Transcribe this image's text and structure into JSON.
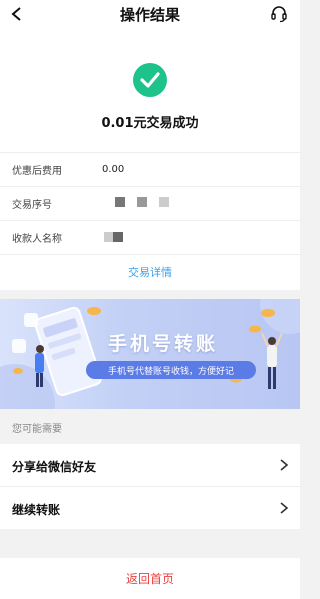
{
  "header": {
    "title": "操作结果",
    "back_icon": "chevron-left-icon",
    "support_icon": "headset-icon"
  },
  "result": {
    "status_icon": "check-circle-icon",
    "amount_text": "0.01元交易成功",
    "rows": [
      {
        "label": "优惠后费用",
        "value": "0.00"
      },
      {
        "label": "交易序号",
        "value": ""
      },
      {
        "label": "收款人名称",
        "value": ""
      }
    ],
    "detail_link": "交易详情"
  },
  "banner": {
    "title": "手机号转账",
    "subtitle": "手机号代替账号收钱，方便好记"
  },
  "section": {
    "label": "您可能需要"
  },
  "actions": [
    {
      "label": "分享给微信好友"
    },
    {
      "label": "继续转账"
    }
  ],
  "footer": {
    "home_label": "返回首页"
  },
  "colors": {
    "accent_green": "#1ec28b",
    "link_blue": "#3aa0e8",
    "home_red": "#e8423f"
  }
}
